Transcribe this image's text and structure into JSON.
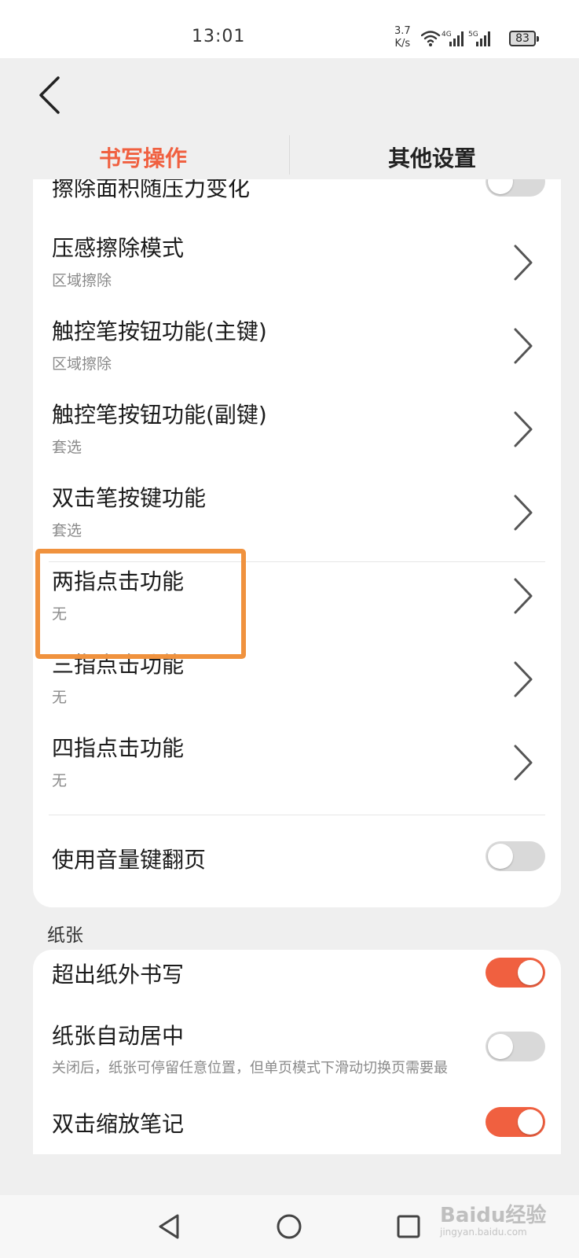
{
  "status_bar": {
    "time": "13:01",
    "speed_value": "3.7",
    "speed_unit": "K/s",
    "battery": "83",
    "net1": "4G",
    "net2": "5G"
  },
  "tabs": [
    {
      "label": "书写操作",
      "active": true
    },
    {
      "label": "其他设置",
      "active": false
    }
  ],
  "card1": {
    "partial_row_label": "擦除面积随压力变化",
    "rows": [
      {
        "title": "压感擦除模式",
        "sub": "区域擦除"
      },
      {
        "title": "触控笔按钮功能(主键)",
        "sub": "区域擦除"
      },
      {
        "title": "触控笔按钮功能(副键)",
        "sub": "套选"
      },
      {
        "title": "双击笔按键功能",
        "sub": "套选"
      },
      {
        "title": "两指点击功能",
        "sub": "无"
      },
      {
        "title": "三指点击功能",
        "sub": "无"
      },
      {
        "title": "四指点击功能",
        "sub": "无"
      }
    ],
    "volume_page_turn": "使用音量键翻页"
  },
  "section_paper": "纸张",
  "card2": {
    "write_outside": "超出纸外书写",
    "auto_center": "纸张自动居中",
    "auto_center_desc": "关闭后，纸张可停留任意位置，但单页模式下滑动切换页需要最",
    "double_tap_zoom": "双击缩放笔记"
  },
  "watermark": {
    "main": "Baidu经验",
    "sub": "jingyan.baidu.com"
  },
  "colors": {
    "accent": "#f06040",
    "highlight": "#f0923e"
  }
}
